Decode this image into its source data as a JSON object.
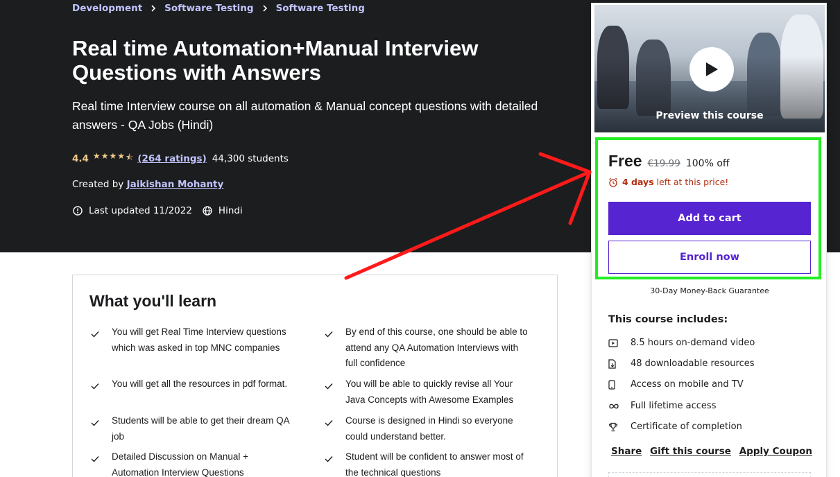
{
  "breadcrumb": [
    "Development",
    "Software Testing",
    "Software Testing"
  ],
  "course": {
    "title": "Real time Automation+Manual Interview Questions with Answers",
    "subtitle": "Real time Interview course on all automation & Manual concept questions with detailed answers - QA Jobs (Hindi)",
    "rating": "4.4",
    "stars": 4.4,
    "ratings_count": "(264 ratings)",
    "students": "44,300 students",
    "created_by_label": "Created by",
    "author": "Jaikishan Mohanty",
    "last_updated": "Last updated 11/2022",
    "language": "Hindi"
  },
  "learn": {
    "title": "What you'll learn",
    "items": [
      "You will get Real Time Interview questions which was asked in top MNC companies",
      "By end of this course, one should be able to attend any QA Automation Interviews with full confidence",
      "You will get all the resources in pdf format.",
      "You will be able to quickly revise all Your Java Concepts with Awesome Examples",
      "Students will be able to get their dream QA job",
      "Course is designed in Hindi so everyone could understand better.",
      "Detailed Discussion on Manual + Automation Interview Questions",
      "Student will be confident to answer most of the technical questions"
    ]
  },
  "sidebar": {
    "preview_label": "Preview this course",
    "price": "Free",
    "original_price": "€19.99",
    "discount": "100% off",
    "deadline_bold": "4 days",
    "deadline_rest": "left at this price!",
    "add_to_cart": "Add to cart",
    "enroll_now": "Enroll now",
    "guarantee": "30-Day Money-Back Guarantee",
    "includes_title": "This course includes:",
    "includes": [
      {
        "icon": "video-icon",
        "text": "8.5 hours on-demand video"
      },
      {
        "icon": "file-download-icon",
        "text": "48 downloadable resources"
      },
      {
        "icon": "mobile-icon",
        "text": "Access on mobile and TV"
      },
      {
        "icon": "infinity-icon",
        "text": "Full lifetime access"
      },
      {
        "icon": "trophy-icon",
        "text": "Certificate of completion"
      }
    ],
    "share": "Share",
    "gift": "Gift this course",
    "coupon": "Apply Coupon"
  },
  "colors": {
    "hero_bg": "#1c1d1f",
    "link_purple": "#c0c4fc",
    "star": "#f3ca8c",
    "primary": "#5624d0",
    "deadline": "#b32d0f",
    "annotation_green": "#22ee22",
    "annotation_red": "#ff1a1a"
  }
}
